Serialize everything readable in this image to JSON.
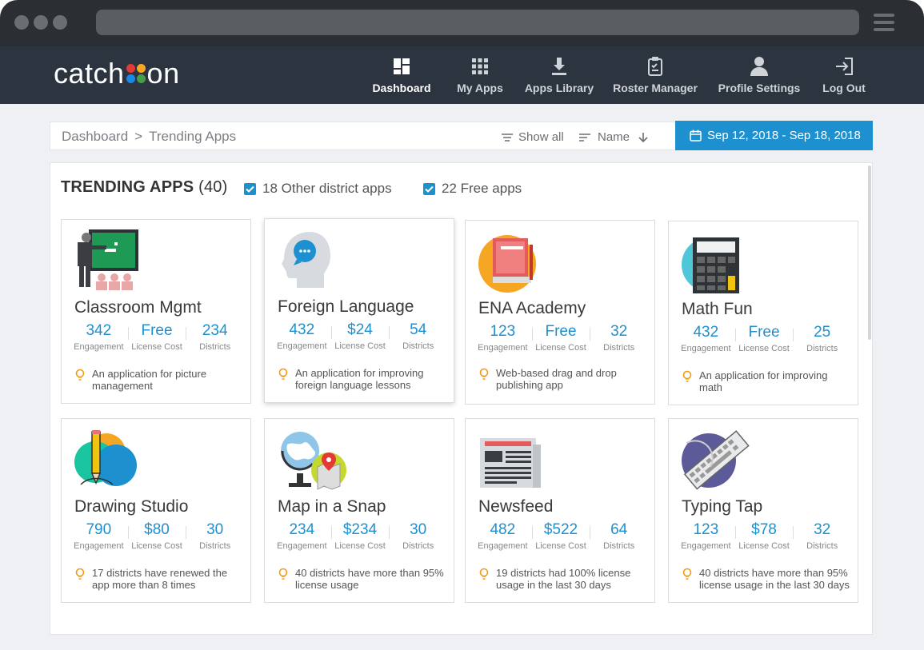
{
  "logo": {
    "text_left": "catch",
    "text_right": "on",
    "dot_colors": [
      "#e53935",
      "#f9a825",
      "#1e88e5",
      "#43a047"
    ]
  },
  "nav": [
    {
      "label": "Dashboard",
      "icon": "dashboard-icon",
      "active": true
    },
    {
      "label": "My Apps",
      "icon": "grid-icon",
      "active": false
    },
    {
      "label": "Apps Library",
      "icon": "download-icon",
      "active": false
    },
    {
      "label": "Roster Manager",
      "icon": "clipboard-icon",
      "active": false
    },
    {
      "label": "Profile Settings",
      "icon": "user-icon",
      "active": false
    },
    {
      "label": "Log Out",
      "icon": "logout-icon",
      "active": false
    }
  ],
  "breadcrumb": {
    "root": "Dashboard",
    "separator": ">",
    "current": "Trending Apps"
  },
  "filters": {
    "show_all": "Show all",
    "sort": "Name"
  },
  "date_range": "Sep 12, 2018 - Sep 18, 2018",
  "panel": {
    "title": "TRENDING APPS",
    "count": "(40)",
    "checkboxes": [
      {
        "label": "18 Other district apps",
        "checked": true
      },
      {
        "label": "22 Free apps",
        "checked": true
      }
    ]
  },
  "stat_labels": {
    "engagement": "Engagement",
    "license": "License Cost",
    "districts": "Districts"
  },
  "apps": [
    {
      "name": "Classroom Mgmt",
      "engagement": "342",
      "license": "Free",
      "districts": "234",
      "desc": "An application for picture management",
      "icon": "classroom-icon"
    },
    {
      "name": "Foreign Language",
      "engagement": "432",
      "license": "$24",
      "districts": "54",
      "desc": "An application for improving foreign language lessons",
      "icon": "speech-head-icon"
    },
    {
      "name": "ENA Academy",
      "engagement": "123",
      "license": "Free",
      "districts": "32",
      "desc": "Web-based drag and drop publishing app",
      "icon": "book-icon"
    },
    {
      "name": "Math Fun",
      "engagement": "432",
      "license": "Free",
      "districts": "25",
      "desc": "An application for improving math",
      "icon": "calculator-icon"
    },
    {
      "name": "Drawing Studio",
      "engagement": "790",
      "license": "$80",
      "districts": "30",
      "desc": "17 districts have renewed the app more than 8 times",
      "icon": "pencil-icon"
    },
    {
      "name": "Map in a Snap",
      "engagement": "234",
      "license": "$234",
      "districts": "30",
      "desc": "40 districts have more than 95% license usage",
      "icon": "globe-map-icon"
    },
    {
      "name": "Newsfeed",
      "engagement": "482",
      "license": "$522",
      "districts": "64",
      "desc": "19 districts had 100% license usage in the last 30 days",
      "icon": "newspaper-icon"
    },
    {
      "name": "Typing Tap",
      "engagement": "123",
      "license": "$78",
      "districts": "32",
      "desc": "40 districts have more than 95% license usage in the last 30 days",
      "icon": "keyboard-icon"
    }
  ],
  "colors": {
    "accent": "#1d90d0",
    "nav_bg": "#2c3440",
    "bulb": "#f39c12"
  }
}
